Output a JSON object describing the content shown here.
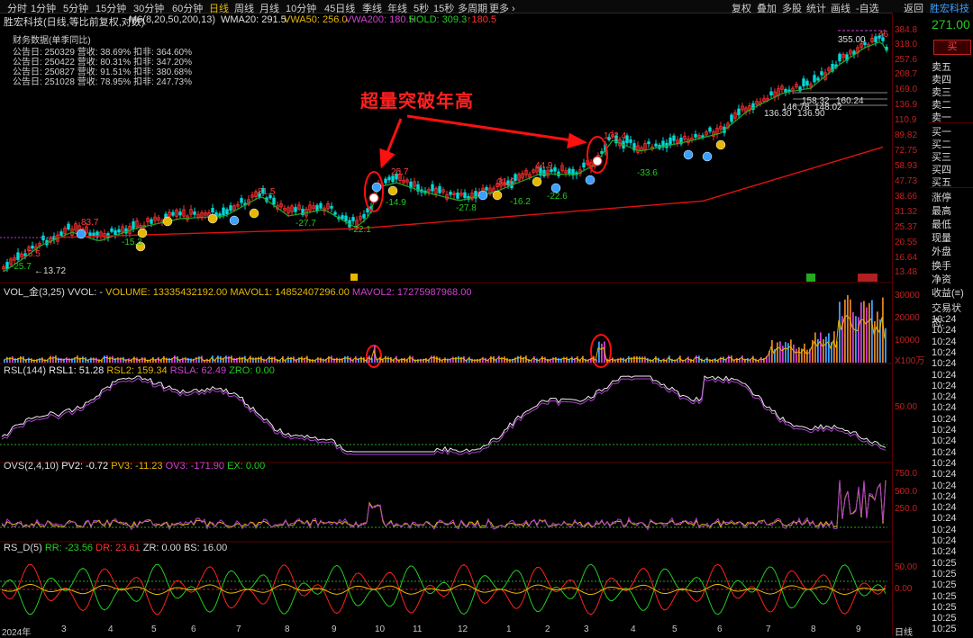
{
  "toolbar": {
    "tabs": [
      "分时",
      "1分钟",
      "5分钟",
      "15分钟",
      "30分钟",
      "60分钟",
      "日线",
      "周线",
      "月线",
      "10分钟",
      "45日线",
      "季线",
      "年线",
      "5秒",
      "15秒",
      "多周期",
      "更多 ›"
    ],
    "active": "日线",
    "right_tools": [
      "复权",
      "叠加",
      "多股",
      "统计",
      "画线",
      "-自选",
      "返回"
    ]
  },
  "header": {
    "title": "胜宏科技(日线,等比前复权,对数)",
    "ma_label": "M6(8,20,50,200,13)",
    "wma20": "WMA20: 291.5",
    "vwa50": "VWA50: 256.0",
    "vwa200": "VWA200: 180.5",
    "hold": "HOLD: 309.3",
    "hold_ch": "↑180.5"
  },
  "financial": {
    "title": "财务数据(单季同比)",
    "rows": [
      "公告日: 250329  营收:  38.69%  扣非:  364.60%",
      "公告日: 250422  营收:  80.31%  扣非:  347.20%",
      "公告日: 250827  营收:  91.51%  扣非:  380.68%",
      "公告日: 251028  营收:  78.95%  扣非:  247.73%"
    ]
  },
  "annotation": "超量突破年高",
  "price_labels": [
    "83.7",
    "-15.3",
    "81.5",
    "-27.7",
    "-22.1",
    "25.7",
    "-14.9",
    "-27.8",
    "31.0",
    "44.9",
    "-16.2",
    "-22.6",
    "103.4",
    "-33.6",
    "-13.5",
    "-25.7",
    "←13.72",
    "355.00",
    "158.32",
    "160.24",
    "146.78",
    "148.02",
    "136.30",
    "136.90",
    "46"
  ],
  "price_axis": [
    "384.8",
    "318.0",
    "257.6",
    "208.7",
    "169.0",
    "136.9",
    "110.9",
    "89.82",
    "72.75",
    "58.93",
    "47.73",
    "38.66",
    "31.32",
    "25.37",
    "20.55",
    "16.64",
    "13.48"
  ],
  "vol": {
    "title": "VOL_金(3,25)",
    "vvol": "VVOL: -",
    "volume": "VOLUME: 13335432192.00",
    "mavol1": "MAVOL1: 14852407296.00",
    "mavol2": "MAVOL2: 17275987968.00",
    "axis": [
      "30000",
      "20000",
      "10000",
      "X100万"
    ]
  },
  "rsl": {
    "title": "RSL(144)",
    "rsl1": "RSL1: 51.28",
    "rsl2": "RSL2: 159.34",
    "rsla": "RSLA: 62.49",
    "zro": "ZRO: 0.00",
    "axis": [
      "50.00"
    ]
  },
  "ovs": {
    "title": "OVS(2,4,10)",
    "pv2": "PV2: -0.72",
    "pv3": "PV3: -11.23",
    "ov3": "OV3: -171.90",
    "ex": "EX: 0.00",
    "axis": [
      "750.0",
      "500.0",
      "250.0"
    ]
  },
  "rsd": {
    "title": "RS_D(5)",
    "rr": "RR: -23.56",
    "dr": "DR: 23.61",
    "zr": "ZR: 0.00",
    "bs": "BS: 16.00",
    "axis": [
      "50.00",
      "0.00"
    ]
  },
  "months": [
    "2024年",
    "3",
    "4",
    "5",
    "6",
    "7",
    "8",
    "9",
    "10",
    "11",
    "12",
    "1",
    "2",
    "3",
    "4",
    "5",
    "6",
    "7",
    "8",
    "9"
  ],
  "period_label": "日线",
  "side": {
    "name": "胜宏科技",
    "price": "271.00",
    "buy_btn": "买",
    "sells": [
      "卖五",
      "卖四",
      "卖三",
      "卖二",
      "卖一"
    ],
    "buys": [
      "买一",
      "买二",
      "买三",
      "买四",
      "买五"
    ],
    "stats": [
      "涨停",
      "最高",
      "最低",
      "现量",
      "外盘",
      "换手",
      "净资",
      "收益(≡)",
      "交易状态:"
    ],
    "times": [
      "10:24",
      "10:24",
      "10:24",
      "10:24",
      "10:24",
      "10:24",
      "10:24",
      "10:24",
      "10:24",
      "10:24",
      "10:24",
      "10:24",
      "10:24",
      "10:24",
      "10:24",
      "10:24",
      "10:24",
      "10:24",
      "10:24",
      "10:24",
      "10:24",
      "10:24",
      "10:25",
      "10:25",
      "10:25",
      "10:25",
      "10:25",
      "10:25",
      "10:25"
    ]
  },
  "colors": {
    "up": "#ff3030",
    "down": "#00d8d8",
    "accent": "#e6b800",
    "ma": "#22aa22",
    "trend": "#e01010"
  }
}
